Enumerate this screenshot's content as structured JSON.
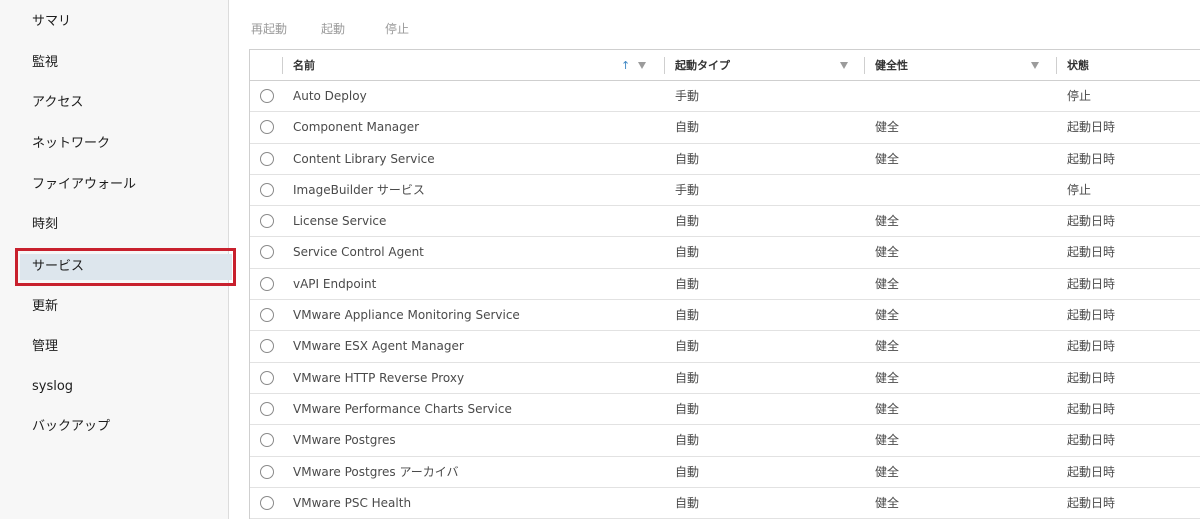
{
  "sidebar": {
    "items": [
      {
        "label": "サマリ"
      },
      {
        "label": "監視"
      },
      {
        "label": "アクセス"
      },
      {
        "label": "ネットワーク"
      },
      {
        "label": "ファイアウォール"
      },
      {
        "label": "時刻"
      },
      {
        "label": "サービス",
        "selected": true
      },
      {
        "label": "更新"
      },
      {
        "label": "管理"
      },
      {
        "label": "syslog"
      },
      {
        "label": "バックアップ"
      }
    ]
  },
  "toolbar": {
    "restart_label": "再起動",
    "start_label": "起動",
    "stop_label": "停止"
  },
  "table": {
    "columns": {
      "name": "名前",
      "startup_type": "起動タイプ",
      "health": "健全性",
      "status": "状態"
    },
    "sort": {
      "column": "name",
      "direction": "ascending"
    },
    "rows": [
      {
        "name": "Auto Deploy",
        "startup_type": "手動",
        "health": "",
        "status": "停止"
      },
      {
        "name": "Component Manager",
        "startup_type": "自動",
        "health": "健全",
        "status": "起動日時"
      },
      {
        "name": "Content Library Service",
        "startup_type": "自動",
        "health": "健全",
        "status": "起動日時"
      },
      {
        "name": "ImageBuilder サービス",
        "startup_type": "手動",
        "health": "",
        "status": "停止"
      },
      {
        "name": "License Service",
        "startup_type": "自動",
        "health": "健全",
        "status": "起動日時"
      },
      {
        "name": "Service Control Agent",
        "startup_type": "自動",
        "health": "健全",
        "status": "起動日時"
      },
      {
        "name": "vAPI Endpoint",
        "startup_type": "自動",
        "health": "健全",
        "status": "起動日時"
      },
      {
        "name": "VMware Appliance Monitoring Service",
        "startup_type": "自動",
        "health": "健全",
        "status": "起動日時"
      },
      {
        "name": "VMware ESX Agent Manager",
        "startup_type": "自動",
        "health": "健全",
        "status": "起動日時"
      },
      {
        "name": "VMware HTTP Reverse Proxy",
        "startup_type": "自動",
        "health": "健全",
        "status": "起動日時"
      },
      {
        "name": "VMware Performance Charts Service",
        "startup_type": "自動",
        "health": "健全",
        "status": "起動日時"
      },
      {
        "name": "VMware Postgres",
        "startup_type": "自動",
        "health": "健全",
        "status": "起動日時"
      },
      {
        "name": "VMware Postgres アーカイバ",
        "startup_type": "自動",
        "health": "健全",
        "status": "起動日時"
      },
      {
        "name": "VMware PSC Health",
        "startup_type": "自動",
        "health": "健全",
        "status": "起動日時"
      }
    ]
  },
  "colors": {
    "selected_nav_bg": "#dde6ed",
    "highlight_border": "#c8202d",
    "sort_arrow": "#3f87c4"
  }
}
